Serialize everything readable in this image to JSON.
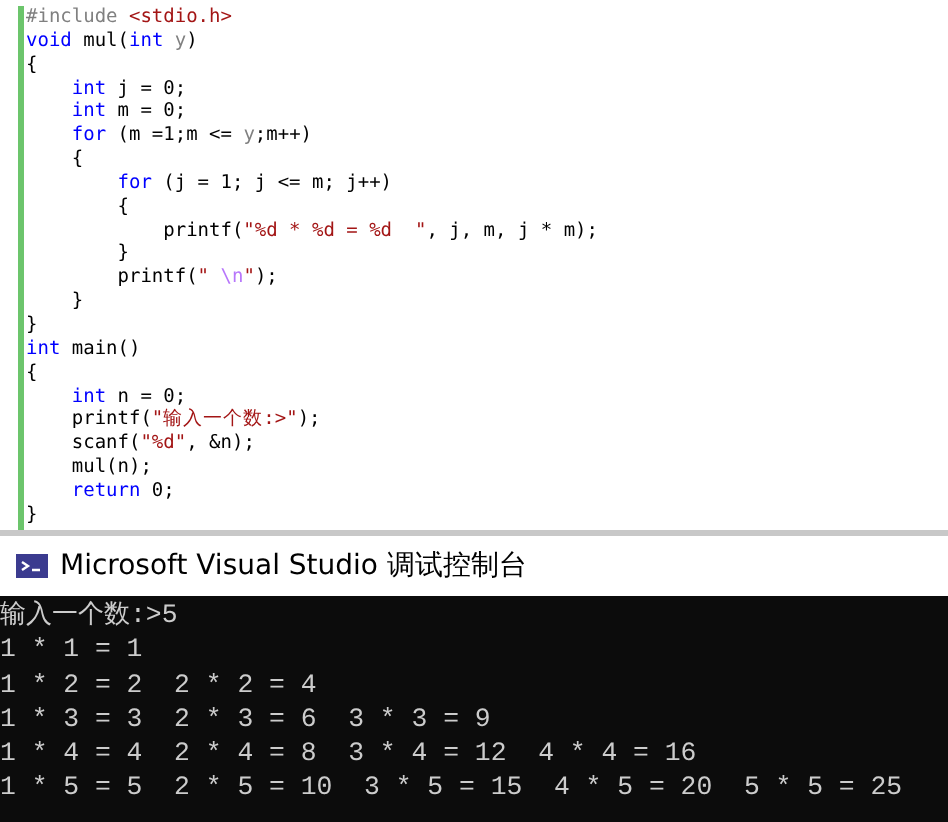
{
  "editor": {
    "lines": [
      {
        "tokens": [
          {
            "kind": "pp",
            "text": "#include "
          },
          {
            "kind": "inc",
            "text": "<stdio.h>"
          }
        ]
      },
      {
        "tokens": [
          {
            "kind": "kw",
            "text": "void"
          },
          {
            "kind": "plain",
            "text": " mul("
          },
          {
            "kind": "kw",
            "text": "int"
          },
          {
            "kind": "param",
            "text": " y"
          },
          {
            "kind": "plain",
            "text": ")"
          }
        ]
      },
      {
        "tokens": [
          {
            "kind": "plain",
            "text": "{"
          }
        ]
      },
      {
        "tokens": [
          {
            "kind": "kw",
            "text": "    int"
          },
          {
            "kind": "plain",
            "text": " j = 0;"
          }
        ]
      },
      {
        "tokens": [
          {
            "kind": "kw",
            "text": "    int"
          },
          {
            "kind": "plain",
            "text": " m = 0;"
          }
        ]
      },
      {
        "tokens": [
          {
            "kind": "kw",
            "text": "    for"
          },
          {
            "kind": "plain",
            "text": " (m =1;m <= "
          },
          {
            "kind": "param",
            "text": "y"
          },
          {
            "kind": "plain",
            "text": ";m++)"
          }
        ]
      },
      {
        "tokens": [
          {
            "kind": "plain",
            "text": "    {"
          }
        ]
      },
      {
        "tokens": [
          {
            "kind": "kw",
            "text": "        for"
          },
          {
            "kind": "plain",
            "text": " (j = 1; j <= m; j++)"
          }
        ]
      },
      {
        "tokens": [
          {
            "kind": "plain",
            "text": "        {"
          }
        ]
      },
      {
        "tokens": [
          {
            "kind": "plain",
            "text": "            printf("
          },
          {
            "kind": "str",
            "text": "\"%d * %d = %d  \""
          },
          {
            "kind": "plain",
            "text": ", j, m, j * m);"
          }
        ]
      },
      {
        "tokens": [
          {
            "kind": "plain",
            "text": "        }"
          }
        ]
      },
      {
        "tokens": [
          {
            "kind": "plain",
            "text": "        printf("
          },
          {
            "kind": "str",
            "text": "\" "
          },
          {
            "kind": "esc",
            "text": "\\n"
          },
          {
            "kind": "str",
            "text": "\""
          },
          {
            "kind": "plain",
            "text": ");"
          }
        ]
      },
      {
        "tokens": [
          {
            "kind": "plain",
            "text": "    }"
          }
        ]
      },
      {
        "tokens": [
          {
            "kind": "plain",
            "text": "}"
          }
        ]
      },
      {
        "tokens": [
          {
            "kind": "kw",
            "text": "int"
          },
          {
            "kind": "plain",
            "text": " main()"
          }
        ]
      },
      {
        "tokens": [
          {
            "kind": "plain",
            "text": "{"
          }
        ]
      },
      {
        "tokens": [
          {
            "kind": "kw",
            "text": "    int"
          },
          {
            "kind": "plain",
            "text": " n = 0;"
          }
        ]
      },
      {
        "tokens": [
          {
            "kind": "plain",
            "text": "    printf("
          },
          {
            "kind": "str",
            "text": "\"输入一个数:>\""
          },
          {
            "kind": "plain",
            "text": ");"
          }
        ]
      },
      {
        "tokens": [
          {
            "kind": "plain",
            "text": "    scanf("
          },
          {
            "kind": "str",
            "text": "\"%d\""
          },
          {
            "kind": "plain",
            "text": ", &n);"
          }
        ]
      },
      {
        "tokens": [
          {
            "kind": "plain",
            "text": "    mul(n);"
          }
        ]
      },
      {
        "tokens": [
          {
            "kind": "kw",
            "text": "    return"
          },
          {
            "kind": "plain",
            "text": " 0;"
          }
        ]
      },
      {
        "tokens": [
          {
            "kind": "plain",
            "text": "}"
          }
        ]
      }
    ]
  },
  "console": {
    "title": "Microsoft Visual Studio 调试控制台",
    "output": [
      "输入一个数:>5",
      "1 * 1 = 1",
      "1 * 2 = 2  2 * 2 = 4",
      "1 * 3 = 3  2 * 3 = 6  3 * 3 = 9",
      "1 * 4 = 4  2 * 4 = 8  3 * 4 = 12  4 * 4 = 16",
      "1 * 5 = 5  2 * 5 = 10  3 * 5 = 15  4 * 5 = 20  5 * 5 = 25"
    ]
  }
}
